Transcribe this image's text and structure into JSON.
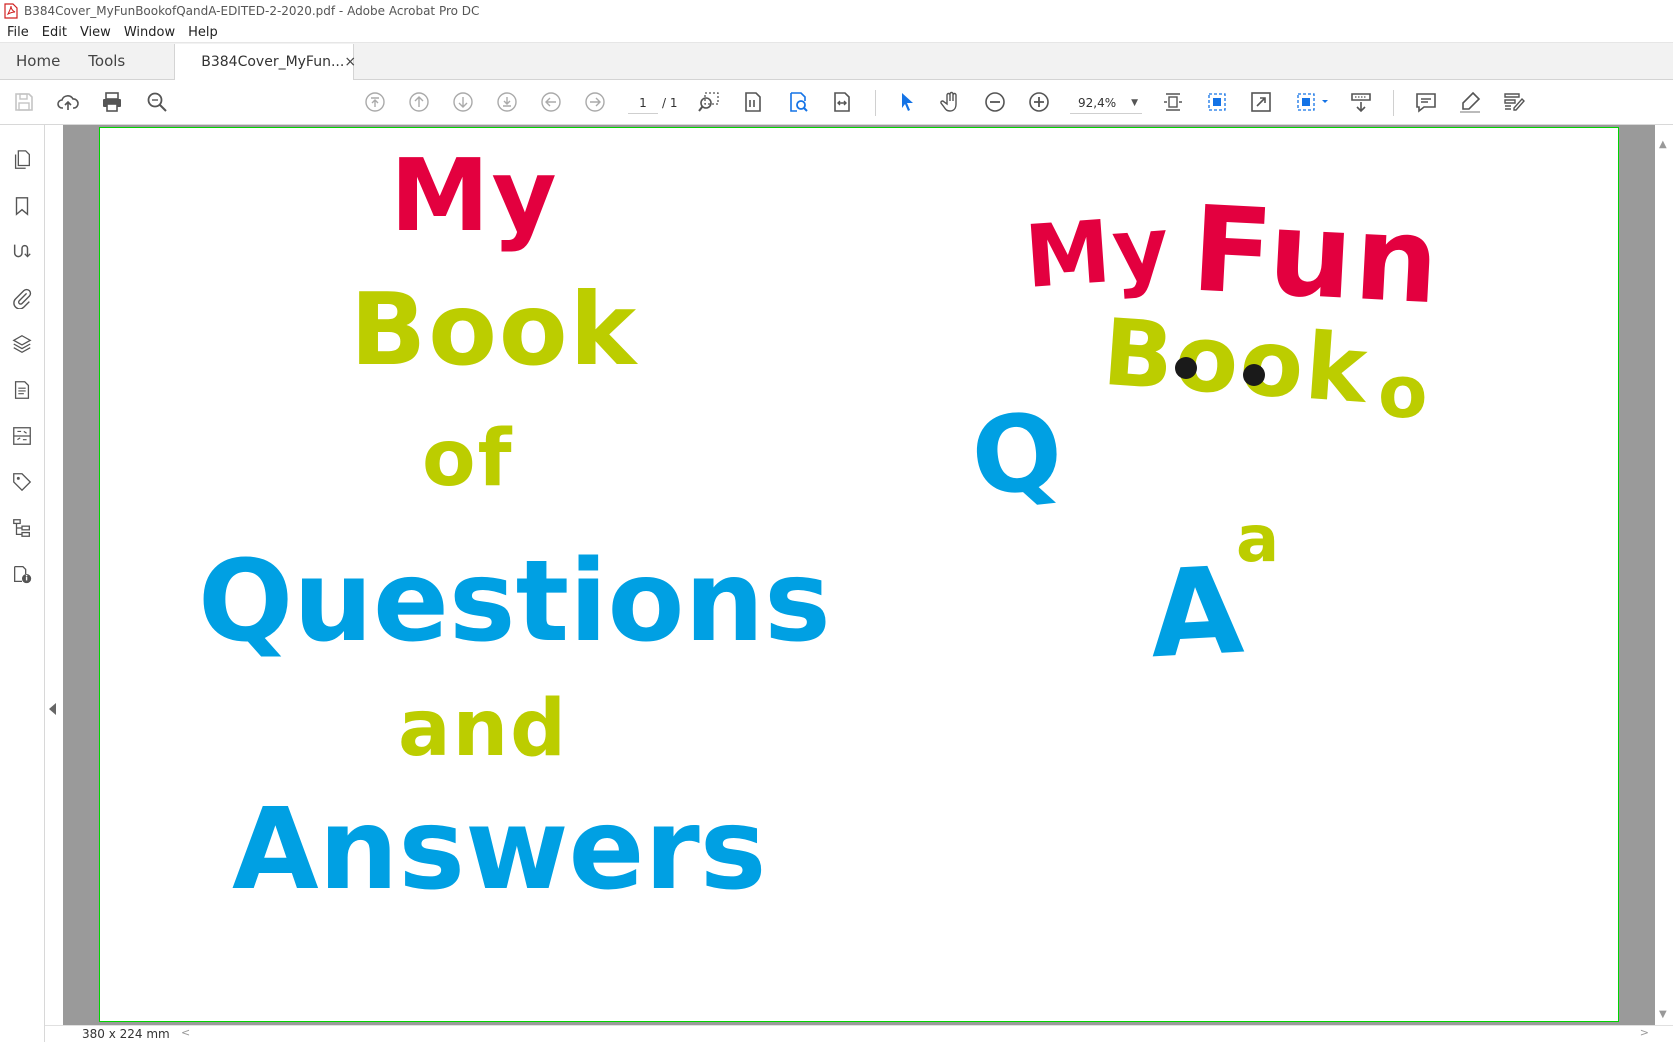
{
  "window": {
    "title": "B384Cover_MyFunBookofQandA-EDITED-2-2020.pdf - Adobe Acrobat Pro DC"
  },
  "menu": {
    "items": [
      "File",
      "Edit",
      "View",
      "Window",
      "Help"
    ]
  },
  "tabs": {
    "home": "Home",
    "tools": "Tools",
    "document": "B384Cover_MyFun...",
    "close": "×"
  },
  "toolbar": {
    "page_current": "1",
    "page_total": "/ 1",
    "zoom": "92,4%"
  },
  "page": {
    "left_title": {
      "my": "My",
      "book": "Book",
      "of": "of",
      "questions": "Questions",
      "and": "and",
      "answers": "Answers"
    },
    "logo": {
      "my": "My",
      "fun": "Fun",
      "book": "Book",
      "o": "o",
      "q": "Q",
      "a_big": "A",
      "a_small": "a"
    }
  },
  "status": {
    "page_size": "380 x 224 mm"
  },
  "colors": {
    "red": "#e3003f",
    "lime": "#bccd00",
    "blue": "#00a0e3",
    "acrobat_blue": "#1473e6",
    "viewer_gray": "#9a9a9a",
    "page_border": "#00d400"
  },
  "icons": {
    "toolbar": [
      "save-icon",
      "upload-icon",
      "print-icon",
      "search-icon",
      "first-page-icon",
      "previous-page-icon",
      "next-page-icon",
      "last-page-icon",
      "back-icon",
      "forward-icon",
      "marquee-zoom-icon",
      "page-view-icon",
      "find-text-icon",
      "fit-width-icon",
      "select-tool-icon",
      "hand-tool-icon",
      "zoom-out-icon",
      "zoom-in-icon",
      "fit-page-icon",
      "rotate-icon",
      "full-screen-icon",
      "page-layout-icon",
      "read-mode-icon",
      "comment-icon",
      "highlight-icon",
      "fill-sign-icon"
    ],
    "left_rail": [
      "pages-icon",
      "bookmark-icon",
      "signature-icon",
      "attachment-icon",
      "layers-icon",
      "document-icon",
      "order-icon",
      "tags-icon",
      "content-icon",
      "accessibility-icon"
    ]
  }
}
